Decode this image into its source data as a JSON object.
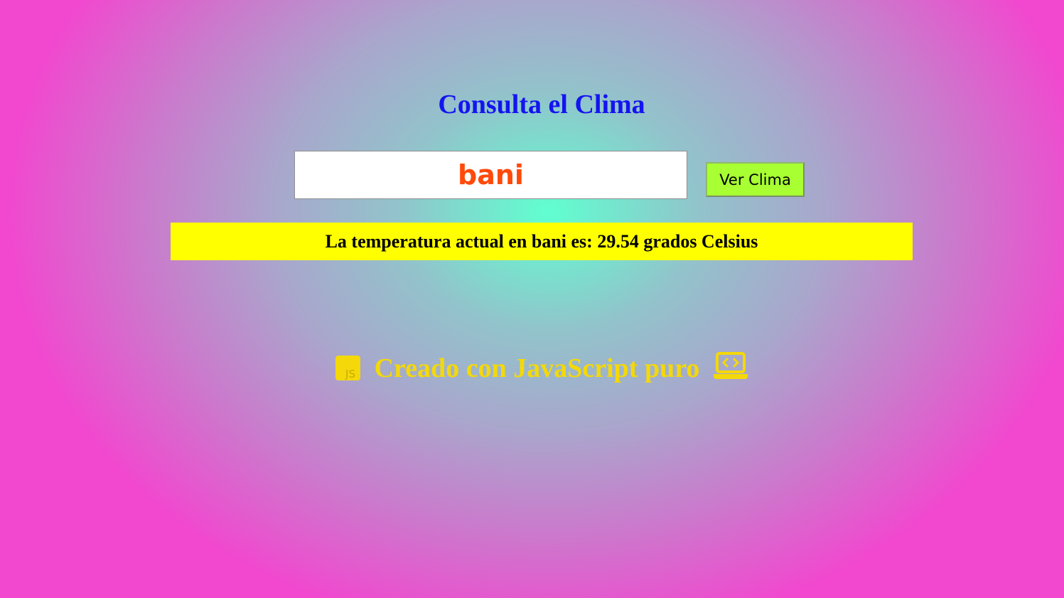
{
  "page": {
    "title": "Consulta el Clima"
  },
  "search": {
    "value": "bani",
    "button_label": "Ver Clima"
  },
  "result": {
    "text": "La temperatura actual en bani es: 29.54 grados Celsius"
  },
  "footer": {
    "text": "Creado con JavaScript puro",
    "left_icon": "javascript-icon",
    "right_icon": "laptop-code-icon"
  },
  "colors": {
    "title": "#1414f0",
    "input_text": "#ff4a0a",
    "button_bg": "#a8ff32",
    "result_bg": "#ffff00",
    "footer_text": "#f4d80a",
    "gradient_center": "#60ffd0",
    "gradient_edge": "#f148cf"
  }
}
